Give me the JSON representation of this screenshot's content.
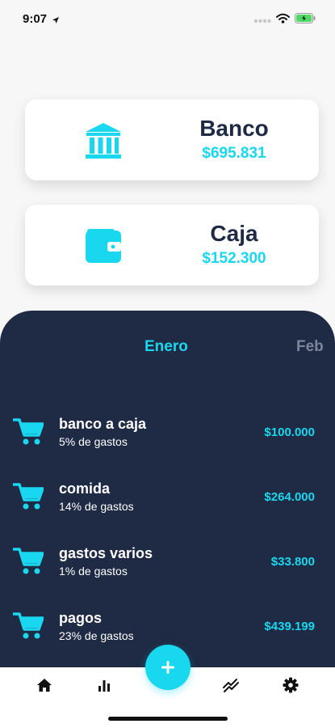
{
  "status_bar": {
    "time": "9:07",
    "icons": [
      "location-arrow-icon",
      "signal-dots-icon",
      "wifi-icon",
      "battery-charging-icon"
    ]
  },
  "accounts": [
    {
      "name": "Banco",
      "amount": "$695.831",
      "icon": "bank-icon"
    },
    {
      "name": "Caja",
      "amount": "$152.300",
      "icon": "wallet-icon"
    }
  ],
  "month_tabs": {
    "active": "Enero",
    "next": "Feb"
  },
  "expenses": [
    {
      "name": "banco a caja",
      "percent": "5% de gastos",
      "amount": "$100.000",
      "icon": "shopping-cart-icon"
    },
    {
      "name": "comida",
      "percent": "14% de gastos",
      "amount": "$264.000",
      "icon": "shopping-cart-icon"
    },
    {
      "name": "gastos varios",
      "percent": "1% de gastos",
      "amount": "$33.800",
      "icon": "shopping-cart-icon"
    },
    {
      "name": "pagos",
      "percent": "23% de gastos",
      "amount": "$439.199",
      "icon": "shopping-cart-icon"
    }
  ],
  "tab_bar": {
    "items": [
      "home-icon",
      "bar-chart-icon",
      "add-icon",
      "trend-icon",
      "gear-icon"
    ],
    "add_label": "+"
  },
  "colors": {
    "accent": "#19d7ee",
    "panel": "#1f2a44",
    "background": "#f7f7f8",
    "card": "#ffffff"
  }
}
